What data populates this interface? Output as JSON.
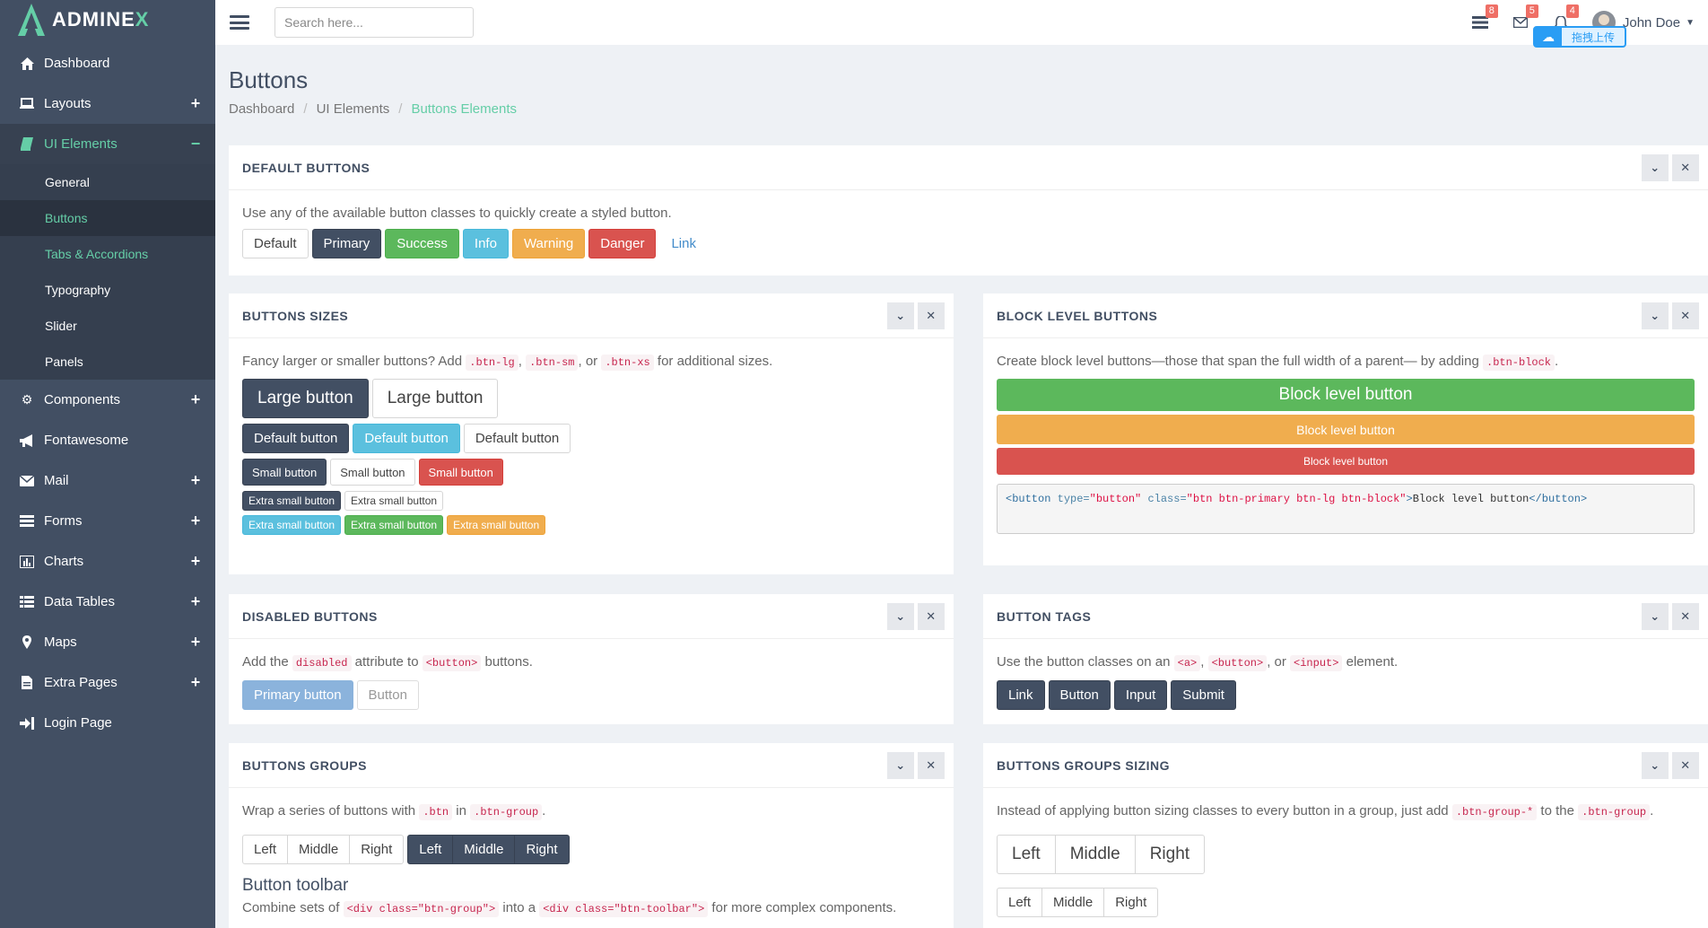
{
  "brand": {
    "name_main": "ADMINE",
    "name_x": "X"
  },
  "sidebar": {
    "items": [
      {
        "label": "Dashboard",
        "icon": "home-icon"
      },
      {
        "label": "Layouts",
        "icon": "laptop-icon",
        "toggle": "+"
      },
      {
        "label": "UI Elements",
        "icon": "book-icon",
        "toggle": "−"
      },
      {
        "label": "Components",
        "icon": "cogs-icon",
        "toggle": "+"
      },
      {
        "label": "Fontawesome",
        "icon": "bullhorn-icon"
      },
      {
        "label": "Mail",
        "icon": "envelope-icon",
        "toggle": "+"
      },
      {
        "label": "Forms",
        "icon": "tasks-icon",
        "toggle": "+"
      },
      {
        "label": "Charts",
        "icon": "bar-chart-icon",
        "toggle": "+"
      },
      {
        "label": "Data Tables",
        "icon": "th-list-icon",
        "toggle": "+"
      },
      {
        "label": "Maps",
        "icon": "map-marker-icon",
        "toggle": "+"
      },
      {
        "label": "Extra Pages",
        "icon": "file-icon",
        "toggle": "+"
      },
      {
        "label": "Login Page",
        "icon": "sign-in-icon"
      }
    ],
    "sub_items": [
      "General",
      "Buttons",
      "Tabs & Accordions",
      "Typography",
      "Slider",
      "Panels"
    ]
  },
  "header": {
    "search_placeholder": "Search here...",
    "badges": {
      "tasks": "8",
      "mail": "5",
      "notifications": "4"
    },
    "user_name": "John Doe",
    "upload_label": "拖拽上传"
  },
  "page": {
    "title": "Buttons",
    "breadcrumb": [
      "Dashboard",
      "UI Elements",
      "Buttons Elements"
    ]
  },
  "default_buttons": {
    "title": "DEFAULT BUTTONS",
    "desc": "Use any of the available button classes to quickly create a styled button.",
    "buttons": [
      "Default",
      "Primary",
      "Success",
      "Info",
      "Warning",
      "Danger",
      "Link"
    ]
  },
  "sizes": {
    "title": "BUTTONS SIZES",
    "desc_pre": "Fancy larger or smaller buttons? Add ",
    "code1": ".btn-lg",
    "sep1": ", ",
    "code2": ".btn-sm",
    "sep2": ", or ",
    "code3": ".btn-xs",
    "desc_post": " for additional sizes.",
    "large": "Large button",
    "default": "Default button",
    "small": "Small button",
    "xsmall": "Extra small button"
  },
  "block": {
    "title": "BLOCK LEVEL BUTTONS",
    "desc_pre": "Create block level buttons—those that span the full width of a parent— by adding ",
    "code": ".btn-block",
    "desc_post": ".",
    "label": "Block level button",
    "code_sample": {
      "open": "<button",
      "attr1": " type=",
      "val1": "\"button\"",
      "attr2": " class=",
      "val2": "\"btn btn-primary btn-lg btn-block\"",
      "gt": ">",
      "text": "Block level button",
      "close": "</button>"
    }
  },
  "disabled": {
    "title": "DISABLED BUTTONS",
    "desc_pre": "Add the ",
    "code1": "disabled",
    "desc_mid": " attribute to ",
    "code2": "<button>",
    "desc_post": " buttons.",
    "primary": "Primary button",
    "default": "Button"
  },
  "tags": {
    "title": "BUTTON TAGS",
    "desc_pre": "Use the button classes on an ",
    "code1": "<a>",
    "sep1": ", ",
    "code2": "<button>",
    "sep2": ", or ",
    "code3": "<input>",
    "desc_post": " element.",
    "buttons": [
      "Link",
      "Button",
      "Input",
      "Submit"
    ]
  },
  "groups": {
    "title": "BUTTONS GROUPS",
    "desc_pre": "Wrap a series of buttons with ",
    "code1": ".btn",
    "desc_mid": " in ",
    "code2": ".btn-group",
    "desc_post": ".",
    "buttons": [
      "Left",
      "Middle",
      "Right"
    ],
    "toolbar_title": "Button toolbar",
    "toolbar_pre": "Combine sets of ",
    "toolbar_code1": "<div class=\"btn-group\">",
    "toolbar_mid": " into a ",
    "toolbar_code2": "<div class=\"btn-toolbar\">",
    "toolbar_post": " for more complex components."
  },
  "group_sizing": {
    "title": "BUTTONS GROUPS SIZING",
    "desc_pre": "Instead of applying button sizing classes to every button in a group, just add ",
    "code1": ".btn-group-*",
    "desc_mid": " to the ",
    "code2": ".btn-group",
    "desc_post": ".",
    "buttons": [
      "Left",
      "Middle",
      "Right"
    ]
  },
  "colors": {
    "sidebar": "#424f63",
    "accent": "#65cea7",
    "primary": "#424f63",
    "success": "#5cb85c",
    "info": "#5bc0de",
    "warning": "#f0ad4e",
    "danger": "#d9534f"
  }
}
